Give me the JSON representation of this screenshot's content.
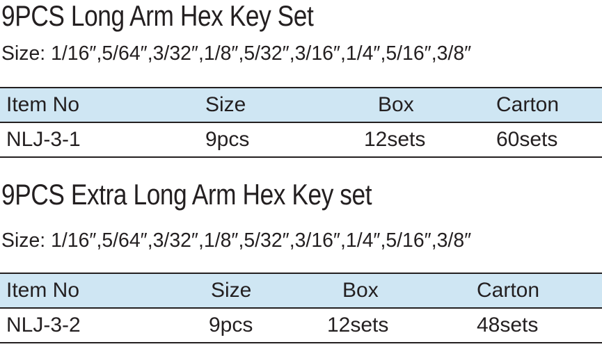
{
  "sections": [
    {
      "title": "9PCS Long Arm Hex Key Set",
      "sizes": "Size: 1/16″,5/64″,3/32″,1/8″,5/32″,3/16″,1/4″,5/16″,3/8″",
      "table": {
        "headers": [
          "Item No",
          "Size",
          "Box",
          "Carton"
        ],
        "row": [
          "NLJ-3-1",
          "9pcs",
          "12sets",
          "60sets"
        ]
      }
    },
    {
      "title": "9PCS Extra Long Arm Hex Key set",
      "sizes": "Size: 1/16″,5/64″,3/32″,1/8″,5/32″,3/16″,1/4″,5/16″,3/8″",
      "table": {
        "headers": [
          "Item No",
          "Size",
          "Box",
          "Carton"
        ],
        "row": [
          "NLJ-3-2",
          "9pcs",
          "12sets",
          "48sets"
        ]
      }
    }
  ],
  "colors": {
    "header_fill": "#cfe6f3",
    "text": "#231f20",
    "rule": "#231f20"
  }
}
